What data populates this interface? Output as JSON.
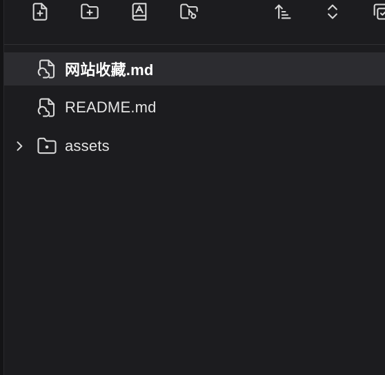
{
  "toolbar": {
    "buttons": [
      {
        "name": "new-note-button",
        "icon": "file-plus-icon"
      },
      {
        "name": "new-folder-button",
        "icon": "folder-plus-icon"
      },
      {
        "name": "change-sort-button",
        "icon": "book-a-icon"
      },
      {
        "name": "reveal-active-file-button",
        "icon": "folder-search-icon"
      },
      {
        "name": "sort-order-button",
        "icon": "sort-ascending-icon"
      },
      {
        "name": "collapse-expand-all-button",
        "icon": "chevrons-up-down-icon"
      },
      {
        "name": "more-button",
        "icon": "copy-folder-icon"
      }
    ]
  },
  "tree": {
    "items": [
      {
        "label": "网站收藏.md",
        "type": "file",
        "icon": "cloud-file-icon",
        "active": true
      },
      {
        "label": "README.md",
        "type": "file",
        "icon": "cloud-file-icon",
        "active": false
      },
      {
        "label": "assets",
        "type": "folder",
        "icon": "folder-icon",
        "collapsed": true
      }
    ]
  },
  "colors": {
    "background": "#1c1c1f",
    "active_row": "#2c2c30",
    "text": "#e4e4e4",
    "icon": "#d8d8d8"
  }
}
